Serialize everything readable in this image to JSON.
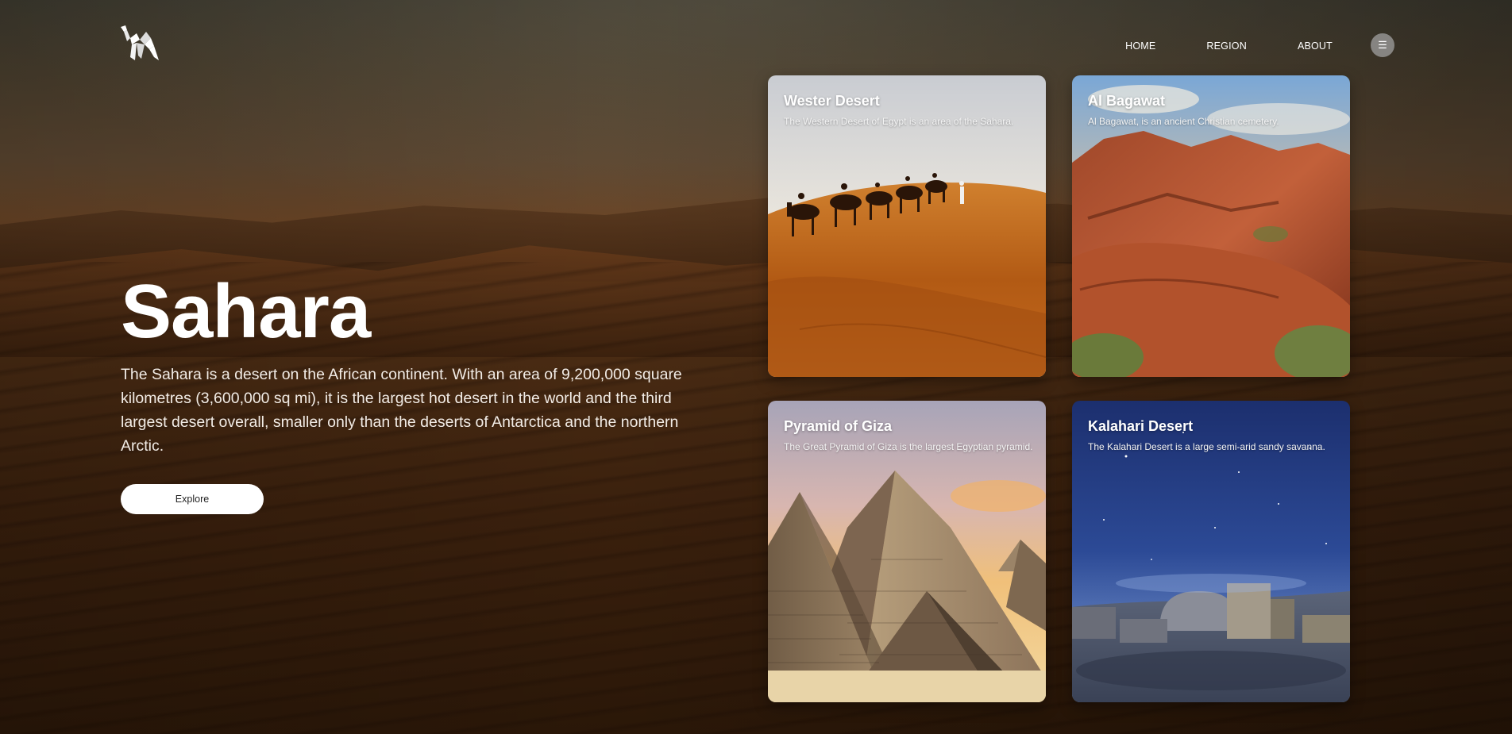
{
  "nav": {
    "items": [
      {
        "label": "HOME"
      },
      {
        "label": "REGION"
      },
      {
        "label": "ABOUT"
      }
    ],
    "menu_icon": "menu-icon"
  },
  "logo": {
    "icon": "camel-logo-icon"
  },
  "hero": {
    "title": "Sahara",
    "description": "The Sahara is a desert on the African continent. With an area of 9,200,000 square kilometres (3,600,000 sq mi), it is the largest hot desert in the world and the third largest desert overall, smaller only than the deserts of Antarctica and the northern Arctic.",
    "button_label": "Explore"
  },
  "cards": [
    {
      "title": "Wester Desert",
      "description": "The Western Desert of Egypt is an area of the Sahara."
    },
    {
      "title": "Al Bagawat",
      "description": "Al Bagawat, is an ancient Christian cemetery."
    },
    {
      "title": "Pyramid of Giza",
      "description": "The Great Pyramid of Giza is the largest Egyptian pyramid."
    },
    {
      "title": "Kalahari Desert",
      "description": "The Kalahari Desert is a large semi-arid sandy savanna."
    }
  ]
}
